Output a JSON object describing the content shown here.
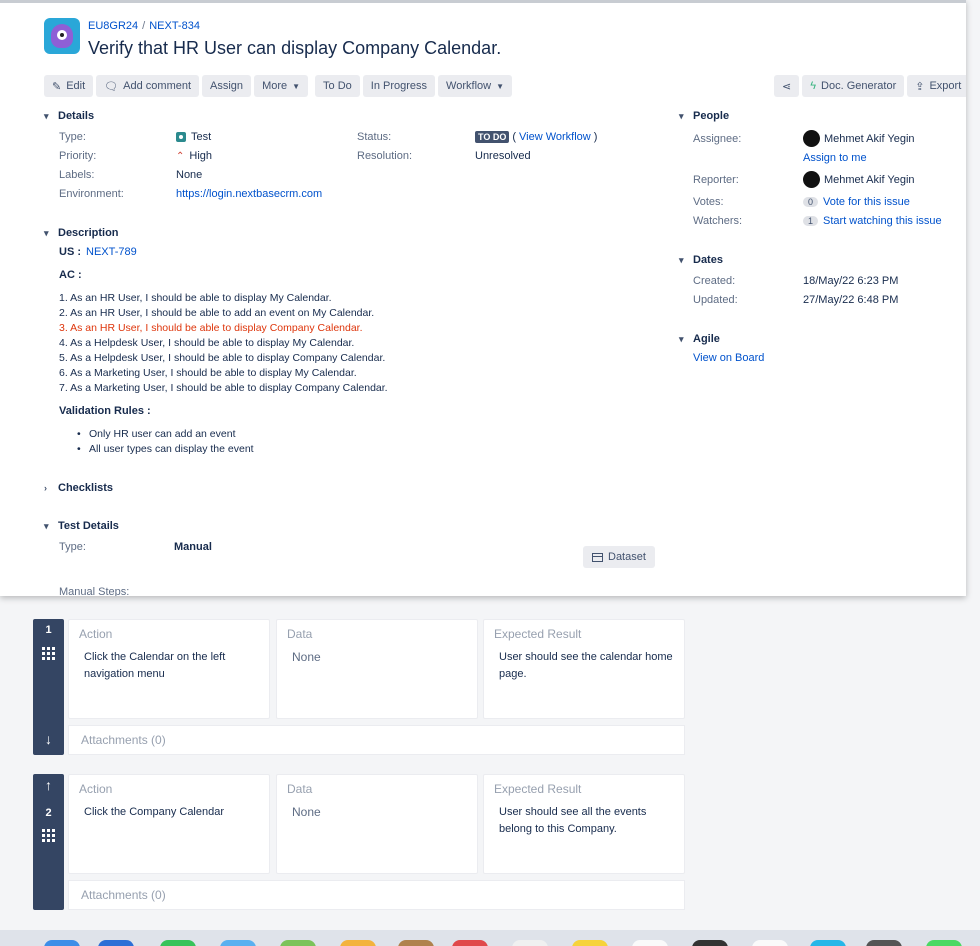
{
  "issue": {
    "project_key": "EU8GR24",
    "issue_key": "NEXT-834",
    "title": "Verify that HR User can display Company Calendar."
  },
  "toolbar": {
    "edit": "Edit",
    "add_comment": "Add comment",
    "assign": "Assign",
    "more": "More",
    "todo": "To Do",
    "in_progress": "In Progress",
    "workflow": "Workflow",
    "doc_generator": "Doc. Generator",
    "export": "Export"
  },
  "details": {
    "heading": "Details",
    "type_label": "Type:",
    "type_value": "Test",
    "priority_label": "Priority:",
    "priority_value": "High",
    "labels_label": "Labels:",
    "labels_value": "None",
    "environment_label": "Environment:",
    "environment_value": "https://login.nextbasecrm.com",
    "status_label": "Status:",
    "status_badge": "TO DO",
    "status_link": "View Workflow",
    "resolution_label": "Resolution:",
    "resolution_value": "Unresolved"
  },
  "description": {
    "heading": "Description",
    "us_label": "US :",
    "us_link": "NEXT-789",
    "ac_label": "AC :",
    "ac_items": [
      "1. As an HR User, I should be able to display My Calendar.",
      "2. As an HR User, I should be able to add an event on My Calendar.",
      "3. As an HR User, I should be able to display Company Calendar.",
      "4. As a Helpdesk User, I should be able to display My Calendar.",
      "5. As a Helpdesk User, I should be able to display Company Calendar.",
      "6. As a Marketing User, I should be able to display My Calendar.",
      "7. As a Marketing User, I should be able to display Company Calendar."
    ],
    "validation_label": "Validation Rules :",
    "validation_items": [
      "Only HR user can add an event",
      "All user types can display the event"
    ]
  },
  "checklists": {
    "heading": "Checklists"
  },
  "test_details": {
    "heading": "Test Details",
    "type_label": "Type:",
    "type_value": "Manual",
    "dataset_button": "Dataset",
    "manual_steps_label": "Manual Steps:"
  },
  "people": {
    "heading": "People",
    "assignee_label": "Assignee:",
    "assignee_name": "Mehmet Akif Yegin",
    "assign_to_me": "Assign to me",
    "reporter_label": "Reporter:",
    "reporter_name": "Mehmet Akif Yegin",
    "votes_label": "Votes:",
    "votes_count": "0",
    "vote_link": "Vote for this issue",
    "watchers_label": "Watchers:",
    "watchers_count": "1",
    "watch_link": "Start watching this issue"
  },
  "dates": {
    "heading": "Dates",
    "created_label": "Created:",
    "created_value": "18/May/22 6:23 PM",
    "updated_label": "Updated:",
    "updated_value": "27/May/22 6:48 PM"
  },
  "agile": {
    "heading": "Agile",
    "view_on_board": "View on Board"
  },
  "steps": [
    {
      "number": "1",
      "action_header": "Action",
      "action": "Click the Calendar on the left navigation menu",
      "data_header": "Data",
      "data": "None",
      "expected_header": "Expected Result",
      "expected": "User should see the calendar home page.",
      "attachments": "Attachments (0)"
    },
    {
      "number": "2",
      "action_header": "Action",
      "action": "Click the Company Calendar",
      "data_header": "Data",
      "data": "None",
      "expected_header": "Expected Result",
      "expected": "User should see all the events belong to this Company.",
      "attachments": "Attachments (0)"
    }
  ],
  "colors": {
    "accent": "#0052cc",
    "rail": "#344563",
    "highlight_red": "#de350b"
  }
}
